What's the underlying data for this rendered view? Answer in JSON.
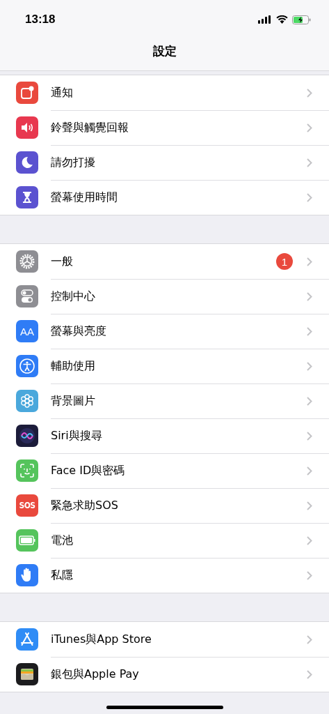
{
  "status_bar": {
    "time": "13:18"
  },
  "nav": {
    "title": "設定"
  },
  "groups": [
    {
      "items": [
        {
          "kind": "notifications",
          "color": "#e9493d",
          "label": "通知"
        },
        {
          "kind": "sounds",
          "color": "#e8384f",
          "label": "鈴聲與觸覺回報"
        },
        {
          "kind": "moon",
          "color": "#5b52d0",
          "label": "請勿打擾"
        },
        {
          "kind": "hourglass",
          "color": "#5b52d0",
          "label": "螢幕使用時間"
        }
      ]
    },
    {
      "items": [
        {
          "kind": "gear",
          "color": "#8e8e93",
          "label": "一般",
          "badge": "1"
        },
        {
          "kind": "toggles",
          "color": "#8e8e93",
          "label": "控制中心"
        },
        {
          "kind": "textsize",
          "color": "#2f7cf6",
          "label": "螢幕與亮度",
          "icon_text": "AA"
        },
        {
          "kind": "accessibility",
          "color": "#2f7cf6",
          "label": "輔助使用"
        },
        {
          "kind": "flower",
          "color": "#4aa8dc",
          "label": "背景圖片"
        },
        {
          "kind": "siri",
          "color": "#1c1c3a",
          "label": "Siri與搜尋"
        },
        {
          "kind": "face",
          "color": "#55c45c",
          "label": "Face ID與密碼"
        },
        {
          "kind": "sos",
          "color": "#e9493d",
          "label": "緊急求助SOS",
          "icon_text": "SOS"
        },
        {
          "kind": "battery",
          "color": "#55c45c",
          "label": "電池"
        },
        {
          "kind": "hand",
          "color": "#2f7cf6",
          "label": "私隱"
        }
      ]
    },
    {
      "items": [
        {
          "kind": "appstore",
          "color": "#2f8cf6",
          "label": "iTunes與App Store"
        },
        {
          "kind": "wallet",
          "color": "#1c1c1e",
          "label": "銀包與Apple Pay"
        }
      ]
    }
  ]
}
